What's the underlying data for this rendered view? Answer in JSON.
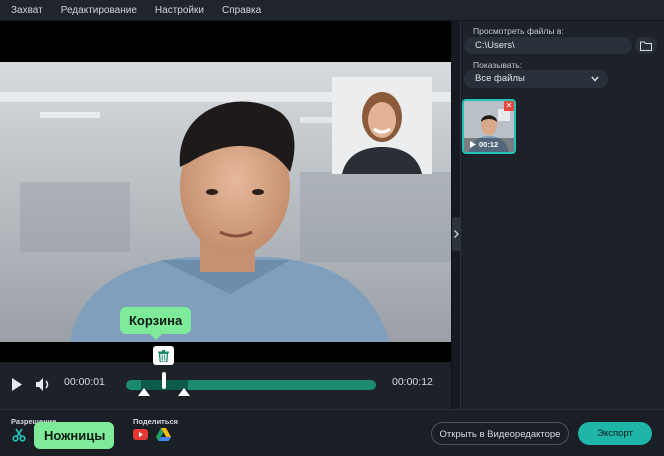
{
  "menu": {
    "items": [
      "Захват",
      "Редактирование",
      "Настройки",
      "Справка"
    ]
  },
  "player": {
    "current_time": "00:00:01",
    "total_time": "00:00:12",
    "progress": 0.08
  },
  "sidebar": {
    "browse_label": "Просмотреть файлы в:",
    "path_value": "C:\\Users\\",
    "show_label": "Показывать:",
    "filter_value": "Все файлы",
    "thumbnail": {
      "duration": "00:12"
    }
  },
  "bottom": {
    "resolution_label": "Разрешение",
    "share_label": "Поделиться",
    "open_editor_label": "Открыть в Видеоредакторе",
    "export_label": "Экспорт"
  },
  "tooltips": {
    "trash": "Корзина",
    "scissors": "Ножницы"
  },
  "colors": {
    "accent": "#23c4b8",
    "tooltip": "#7deb99",
    "track": "#1c8a70",
    "youtube": "#e53935"
  }
}
